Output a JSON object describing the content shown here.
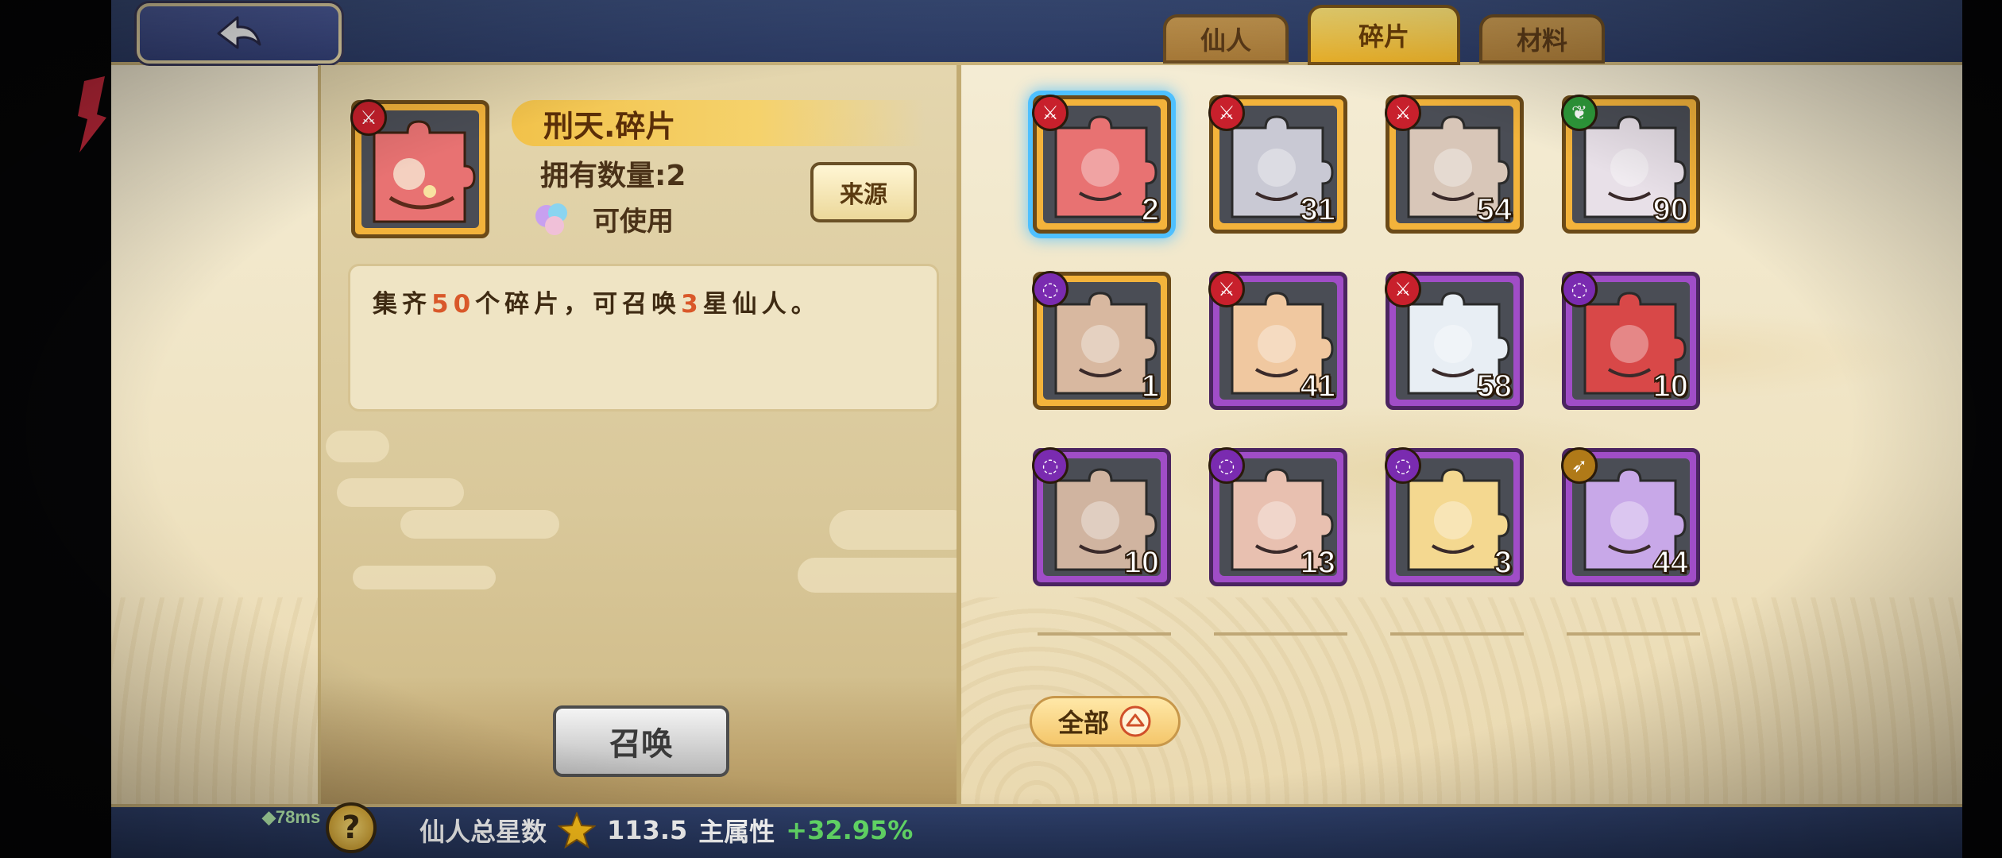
{
  "tabs": [
    {
      "label": "仙人",
      "active": false
    },
    {
      "label": "碎片",
      "active": true
    },
    {
      "label": "材料",
      "active": false
    }
  ],
  "detail": {
    "title": "刑天.碎片",
    "owned": "拥有数量:2",
    "usable": "可使用",
    "source_label": "来源",
    "desc_prefix": "集齐",
    "desc_need": "50",
    "desc_mid": "个碎片，可召唤",
    "desc_star": "3",
    "desc_suffix": "星仙人。",
    "summon_label": "召唤"
  },
  "fragments": [
    {
      "count": "2",
      "frame": "orange",
      "element": "red",
      "icon": "sword-icon",
      "selected": true
    },
    {
      "count": "31",
      "frame": "orange",
      "element": "red",
      "icon": "sword-icon"
    },
    {
      "count": "54",
      "frame": "orange",
      "element": "red",
      "icon": "sword-icon"
    },
    {
      "count": "90",
      "frame": "orange",
      "element": "green",
      "icon": "leaf-icon"
    },
    {
      "count": "1",
      "frame": "orange",
      "element": "purple",
      "icon": "swirl-icon"
    },
    {
      "count": "41",
      "frame": "purple",
      "element": "red",
      "icon": "sword-icon"
    },
    {
      "count": "58",
      "frame": "purple",
      "element": "red",
      "icon": "sword-icon"
    },
    {
      "count": "10",
      "frame": "purple",
      "element": "purple",
      "icon": "swirl-icon"
    },
    {
      "count": "10",
      "frame": "purple",
      "element": "purple",
      "icon": "swirl-icon"
    },
    {
      "count": "13",
      "frame": "purple",
      "element": "purple",
      "icon": "swirl-icon"
    },
    {
      "count": "3",
      "frame": "purple",
      "element": "purple",
      "icon": "swirl-icon"
    },
    {
      "count": "44",
      "frame": "purple",
      "element": "gold",
      "icon": "bow-icon"
    }
  ],
  "filter": {
    "label": "全部"
  },
  "footer": {
    "ping": "78ms",
    "help": "?",
    "stars_label": "仙人总星数",
    "stars_value": "113.5",
    "attr_label": "主属性",
    "attr_value": "+32.95%"
  },
  "colors": {
    "frame_orange": "#f3b33b",
    "frame_purple": "#a04dc7",
    "selected_glow": "#4ec0ff",
    "highlight_number": "#d9582a",
    "bonus_green": "#66e06a"
  }
}
